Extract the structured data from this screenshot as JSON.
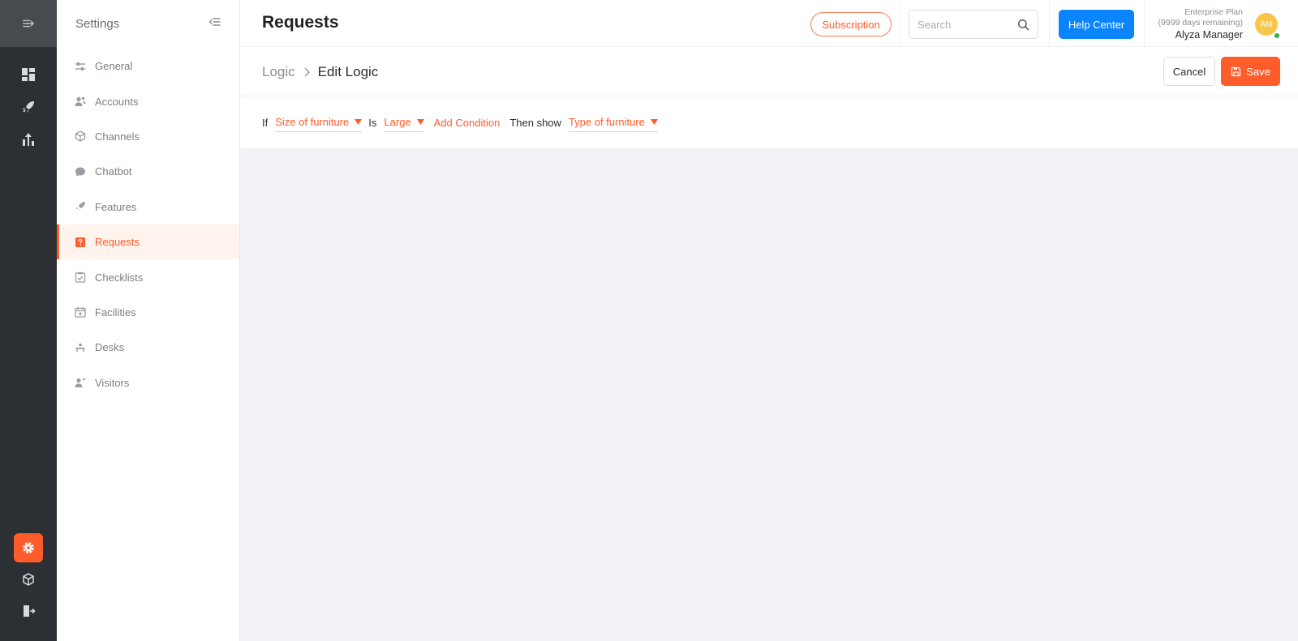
{
  "rail": {
    "menu_icon": "expand-menu-icon",
    "items": [
      {
        "icon": "dashboard-icon"
      },
      {
        "icon": "rocket-icon"
      },
      {
        "icon": "analytics-icon"
      }
    ],
    "bottom": [
      {
        "icon": "gear-icon",
        "active": true
      },
      {
        "icon": "box-icon"
      },
      {
        "icon": "logout-icon"
      }
    ],
    "accent": "#ff5c2b"
  },
  "sidebar": {
    "title": "Settings",
    "items": [
      {
        "label": "General",
        "icon": "sliders-icon"
      },
      {
        "label": "Accounts",
        "icon": "users-icon"
      },
      {
        "label": "Channels",
        "icon": "cube-icon"
      },
      {
        "label": "Chatbot",
        "icon": "chat-bubble-icon"
      },
      {
        "label": "Features",
        "icon": "rocket-icon"
      },
      {
        "label": "Requests",
        "icon": "question-icon",
        "active": true
      },
      {
        "label": "Checklists",
        "icon": "checklist-icon"
      },
      {
        "label": "Facilities",
        "icon": "calendar-plus-icon"
      },
      {
        "label": "Desks",
        "icon": "desk-icon"
      },
      {
        "label": "Visitors",
        "icon": "visitor-icon"
      }
    ]
  },
  "header": {
    "title": "Requests",
    "subscription_label": "Subscription",
    "search_placeholder": "Search",
    "help_label": "Help Center",
    "plan_name": "Enterprise Plan",
    "plan_days": "(9999 days remaining)",
    "user_name": "Alyza Manager",
    "avatar_initials": "AM"
  },
  "subheader": {
    "breadcrumb_root": "Logic",
    "breadcrumb_current": "Edit Logic",
    "cancel_label": "Cancel",
    "save_label": "Save"
  },
  "logic": {
    "if_label": "If",
    "field_value": "Size of furniture",
    "is_label": "Is",
    "condition_value": "Large",
    "add_condition_label": "Add Condition",
    "then_label": "Then show",
    "target_value": "Type of furniture"
  }
}
